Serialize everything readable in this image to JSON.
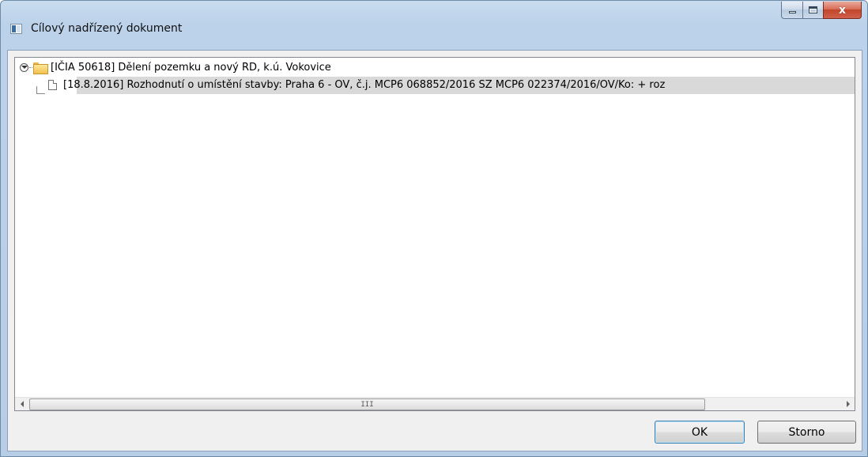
{
  "window": {
    "title": "Cílový nadřízený dokument",
    "icon": "window-icon",
    "controls": {
      "minimize": "minimize-icon",
      "maximize": "maximize-icon",
      "close": "x"
    }
  },
  "tree": {
    "items": [
      {
        "label": "[IČIA 50618] Dělení pozemku  a nový RD, k.ú. Vokovice",
        "icon": "folder-icon",
        "expanded": true
      },
      {
        "label": "[18.8.2016] Rozhodnutí o umístění stavby: Praha 6 - OV, č.j. MCP6 068852/2016 SZ MCP6 022374/2016/OV/Ko: + roz",
        "icon": "document-icon",
        "selected": true
      }
    ],
    "scrollbar": {
      "grip": "III"
    }
  },
  "buttons": {
    "ok": "OK",
    "cancel": "Storno"
  }
}
